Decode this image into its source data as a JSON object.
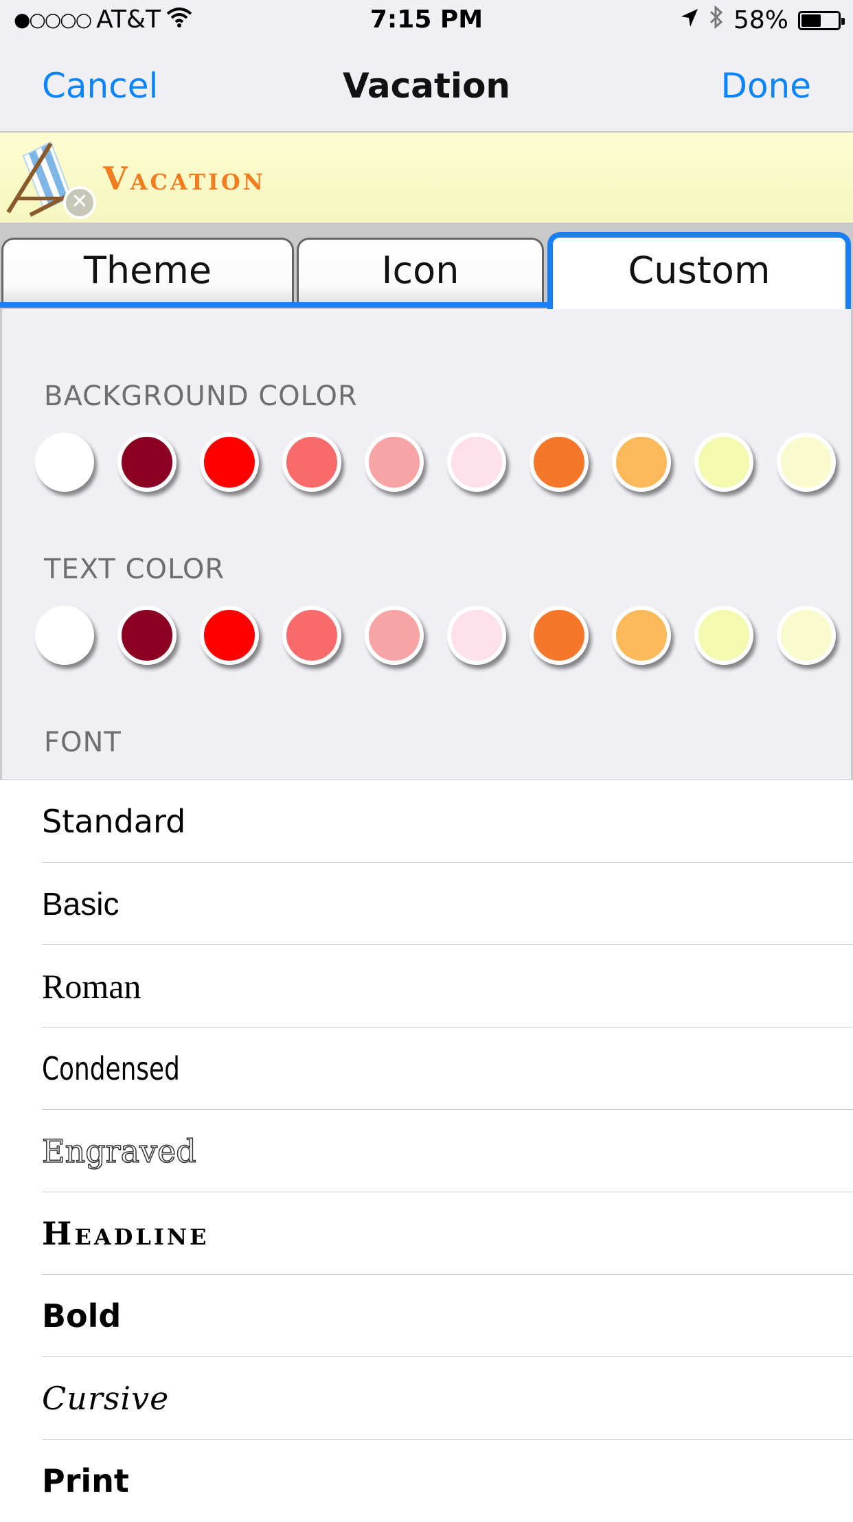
{
  "status_bar": {
    "signal_dots": "●○○○○",
    "carrier": "AT&T",
    "time": "7:15 PM",
    "battery_percent": "58%",
    "battery_level": 0.58,
    "icons": [
      "wifi-icon",
      "location-arrow-icon",
      "bluetooth-icon",
      "battery-icon"
    ]
  },
  "nav": {
    "cancel_label": "Cancel",
    "title": "Vacation",
    "done_label": "Done"
  },
  "banner": {
    "title": "Vacation",
    "icon": "beach-chair-icon",
    "remove_icon": "close-icon"
  },
  "tabs": [
    {
      "label": "Theme",
      "selected": false
    },
    {
      "label": "Icon",
      "selected": false
    },
    {
      "label": "Custom",
      "selected": true
    }
  ],
  "background_color": {
    "label": "BACKGROUND COLOR",
    "swatches": [
      "#ffffff",
      "#8b0022",
      "#ff0000",
      "#f96b6b",
      "#f8a4a4",
      "#fde0ea",
      "#f6762a",
      "#fbb95a",
      "#f4f9b0",
      "#f9fbcc"
    ]
  },
  "text_color": {
    "label": "TEXT COLOR",
    "swatches": [
      "#ffffff",
      "#8b0022",
      "#ff0000",
      "#f96b6b",
      "#f8a4a4",
      "#fde0ea",
      "#f6762a",
      "#fbb95a",
      "#f4f9b0",
      "#f9fbcc"
    ]
  },
  "font": {
    "label": "FONT",
    "options": [
      "Standard",
      "Basic",
      "Roman",
      "Condensed",
      "Engraved",
      "Headline",
      "Bold",
      "Cursive",
      "Print"
    ]
  },
  "colors": {
    "accent": "#0a84ff",
    "tab_highlight": "#1a7ff5",
    "banner_title": "#f27d1f"
  }
}
